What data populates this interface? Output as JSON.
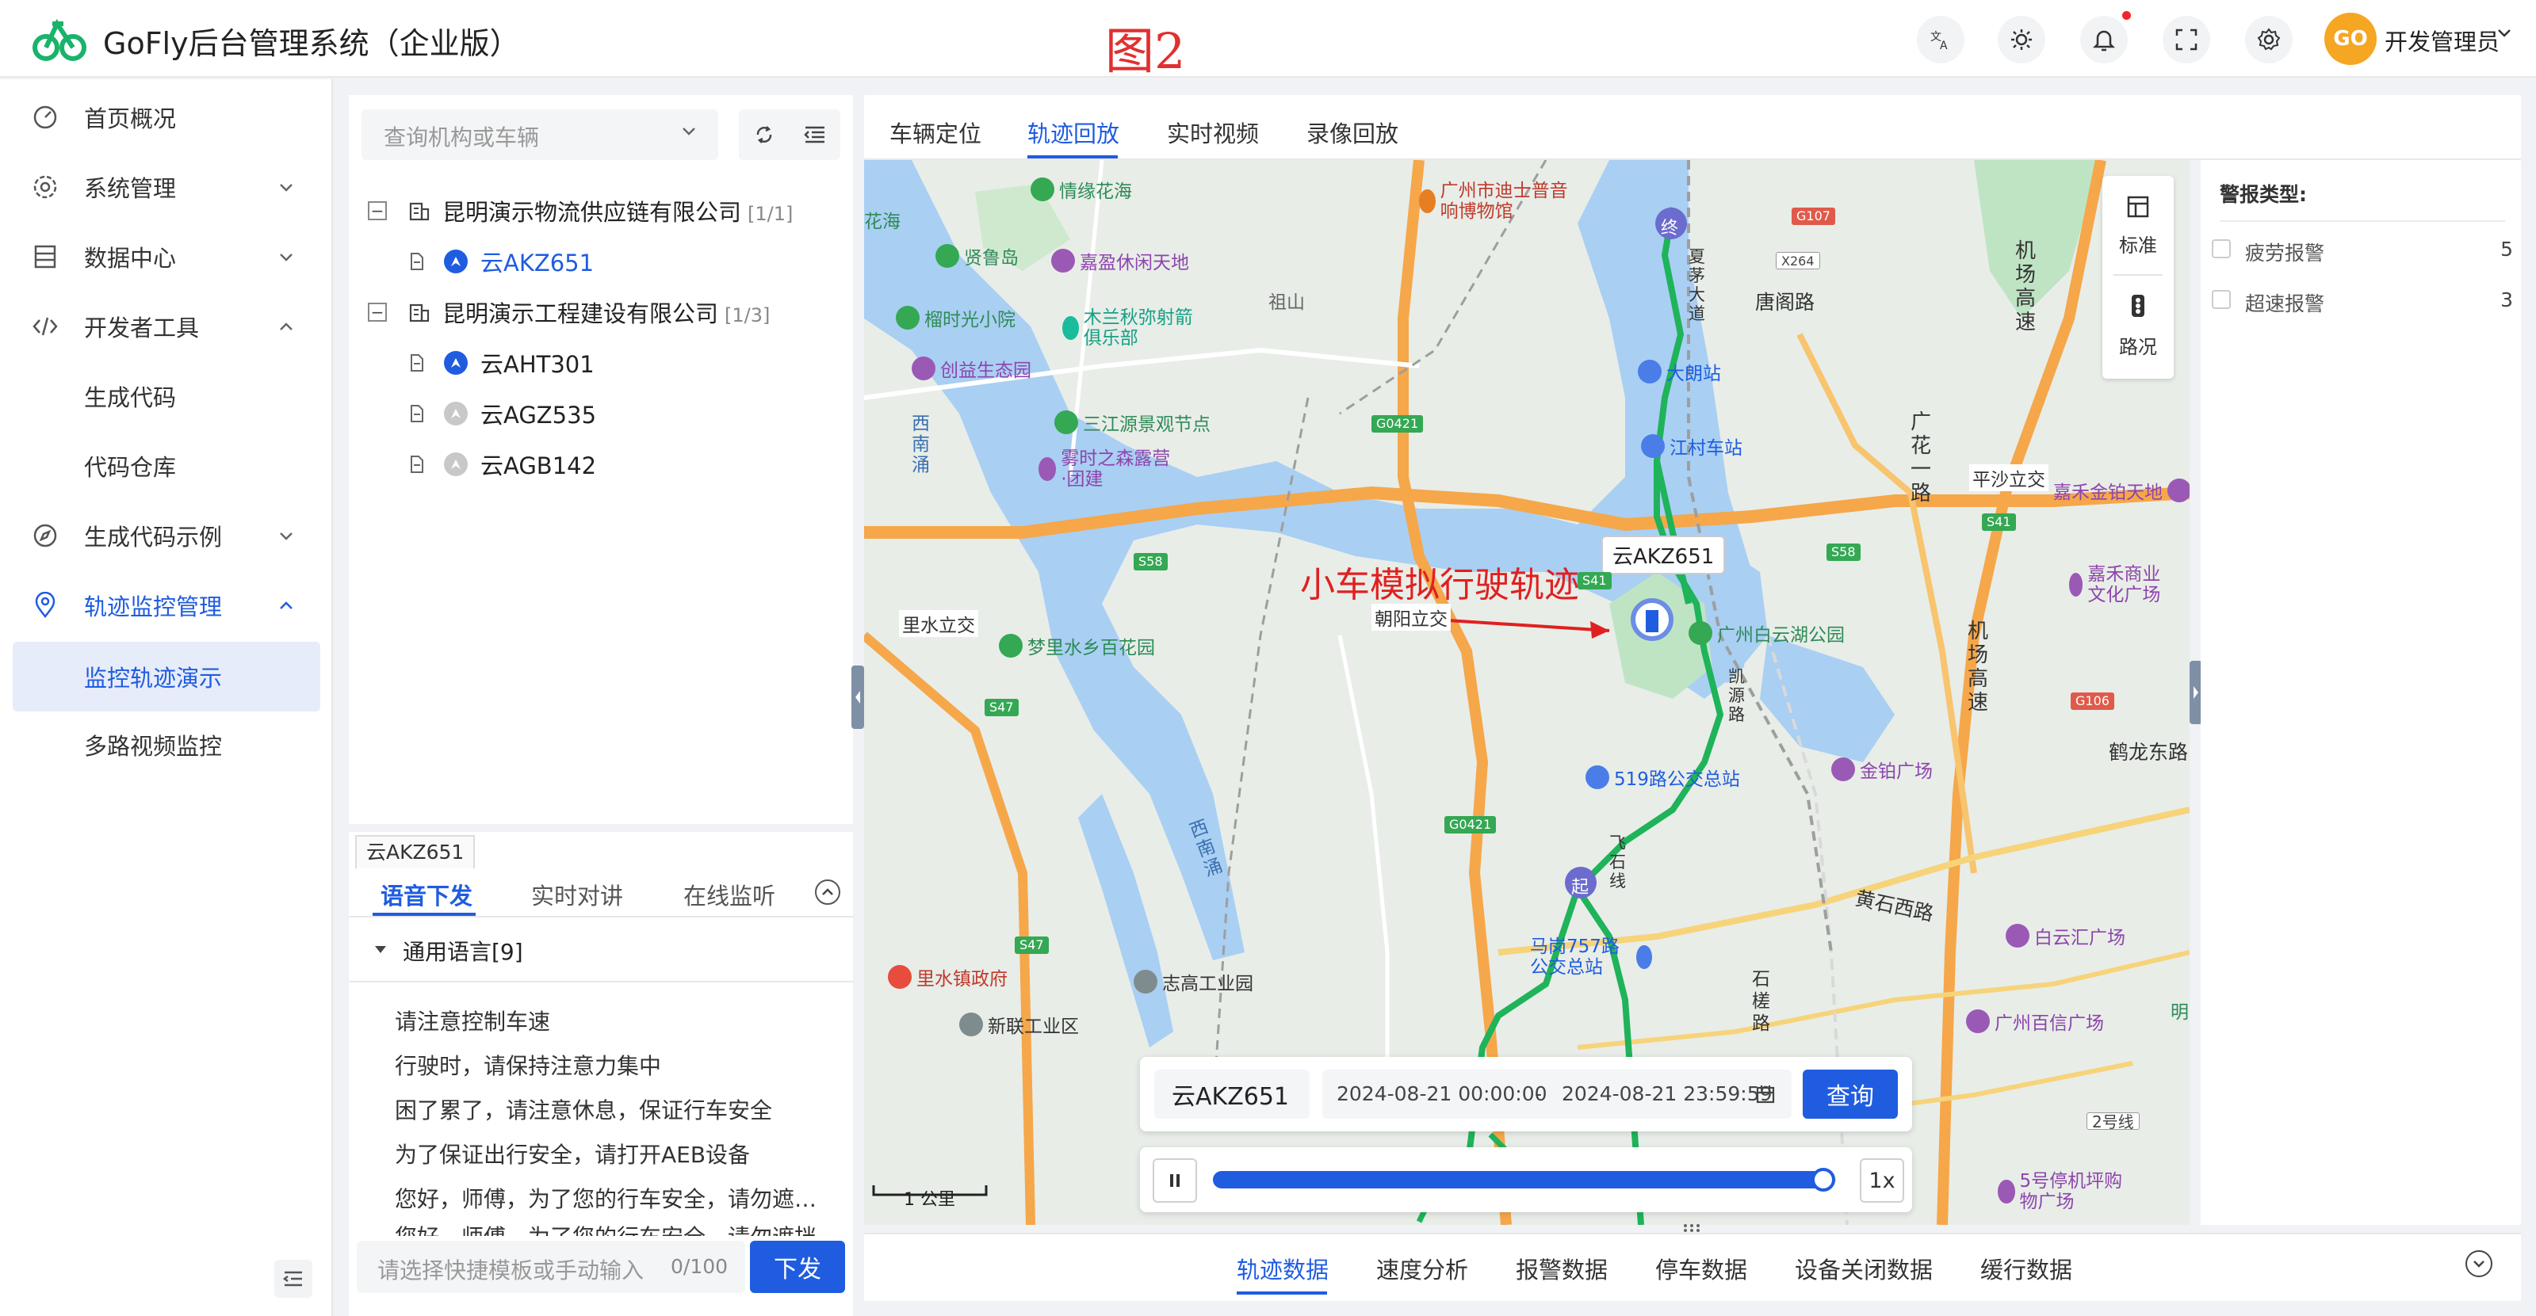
{
  "header": {
    "app_title": "GoFly后台管理系统（企业版）",
    "figure_label": "图2",
    "avatar_text": "GO",
    "user_name": "开发管理员"
  },
  "sidebar": {
    "items": [
      {
        "label": "首页概况",
        "icon": "dashboard-icon"
      },
      {
        "label": "系统管理",
        "icon": "gear-icon"
      },
      {
        "label": "数据中心",
        "icon": "database-icon"
      },
      {
        "label": "开发者工具",
        "icon": "code-icon"
      },
      {
        "label": "生成代码"
      },
      {
        "label": "代码仓库"
      },
      {
        "label": "生成代码示例",
        "icon": "compass-icon"
      },
      {
        "label": "轨迹监控管理",
        "icon": "location-pin-icon"
      },
      {
        "label": "监控轨迹演示"
      },
      {
        "label": "多路视频监控"
      }
    ]
  },
  "tree": {
    "search_placeholder": "查询机构或车辆",
    "orgs": [
      {
        "name": "昆明演示物流供应链有限公司",
        "count": "[1/1]"
      },
      {
        "name": "昆明演示工程建设有限公司",
        "count": "[1/3]"
      }
    ],
    "vehicles": [
      {
        "plate": "云AKZ651",
        "online": true,
        "selected": true
      },
      {
        "plate": "云AHT301",
        "online": true,
        "selected": false
      },
      {
        "plate": "云AGZ535",
        "online": false,
        "selected": false
      },
      {
        "plate": "云AGB142",
        "online": false,
        "selected": false
      }
    ]
  },
  "voice": {
    "vehicle_tag": "云AKZ651",
    "tabs": [
      "语音下发",
      "实时对讲",
      "在线监听"
    ],
    "group_label": "通用语言[9]",
    "phrases": [
      "请注意控制车速",
      "行驶时，请保持注意力集中",
      "困了累了，请注意休息，保证行车安全",
      "为了保证出行安全，请打开AEB设备",
      "您好，师傅，为了您的行车安全，请勿遮挡摄像头",
      "您好，师傅，为了您的行车安全，请勿遮挡"
    ],
    "input_placeholder": "请选择快捷模板或手动输入",
    "input_count": "0/100",
    "send_label": "下发"
  },
  "main_tabs": [
    "车辆定位",
    "轨迹回放",
    "实时视频",
    "录像回放"
  ],
  "map": {
    "controls": [
      "标准",
      "路况"
    ],
    "annotation": "小车模拟行驶轨迹",
    "car_tag": "云AKZ651",
    "start_marker": "起",
    "end_marker": "终",
    "scale": "1 公里",
    "labels": {
      "l1": "情缘花海",
      "l2": "广州市迪士普音响博物馆",
      "l3": "贤鲁岛",
      "l4": "嘉盈休闲天地",
      "l5": "祖山",
      "l6": "唐阁路",
      "l7": "榴时光小院",
      "l8": "木兰秋弥射箭俱乐部",
      "l9": "创益生态园",
      "l10": "大朗站",
      "l11": "三江源景观节点",
      "l12": "江村车站",
      "l13": "雾时之森露营·团建",
      "l14": "平沙立交",
      "l15": "嘉禾金铂天地",
      "l16": "里水立交",
      "l17": "朝阳立交",
      "l18": "广州白云湖公园",
      "l19": "梦里水乡百花园",
      "l20": "嘉禾商业文化广场",
      "l21": "519路公交总站",
      "l22": "金铂广场",
      "l23": "鹤龙东路",
      "l24": "黄石西路",
      "l25": "白云汇广场",
      "l26": "马岗757路公交总站",
      "l27": "里水镇政府",
      "l28": "志高工业园",
      "l29": "广州百信广场",
      "l30": "新联工业区",
      "l31": "5号停机坪购物广场",
      "l32": "花海",
      "l33": "机场高速",
      "l34": "广花一路",
      "l35": "西南涌",
      "l36": "石槎路",
      "l37": "2号线",
      "l38": "明",
      "l39": "机场高速",
      "l40": "西南涌",
      "l41": "夏茅大道",
      "l42": "凯源路",
      "l43": "飞石线"
    },
    "shields": [
      "G107",
      "X264",
      "G0421",
      "S58",
      "S58",
      "S41",
      "S47",
      "G106",
      "G0421",
      "S47",
      "S41"
    ]
  },
  "query": {
    "plate": "云AKZ651",
    "start": "2024-08-21 00:00:00",
    "separator": "-",
    "end": "2024-08-21 23:59:59",
    "button": "查询",
    "speed": "1x",
    "progress": 0.98
  },
  "alarms": {
    "title": "警报类型:",
    "items": [
      {
        "label": "疲劳报警",
        "count": "5"
      },
      {
        "label": "超速报警",
        "count": "3"
      }
    ]
  },
  "bottom_tabs": [
    "轨迹数据",
    "速度分析",
    "报警数据",
    "停车数据",
    "设备关闭数据",
    "缓行数据"
  ],
  "colors": {
    "accent": "#1f5ce0",
    "track": "#1fb35a",
    "annotation": "#e02020"
  }
}
